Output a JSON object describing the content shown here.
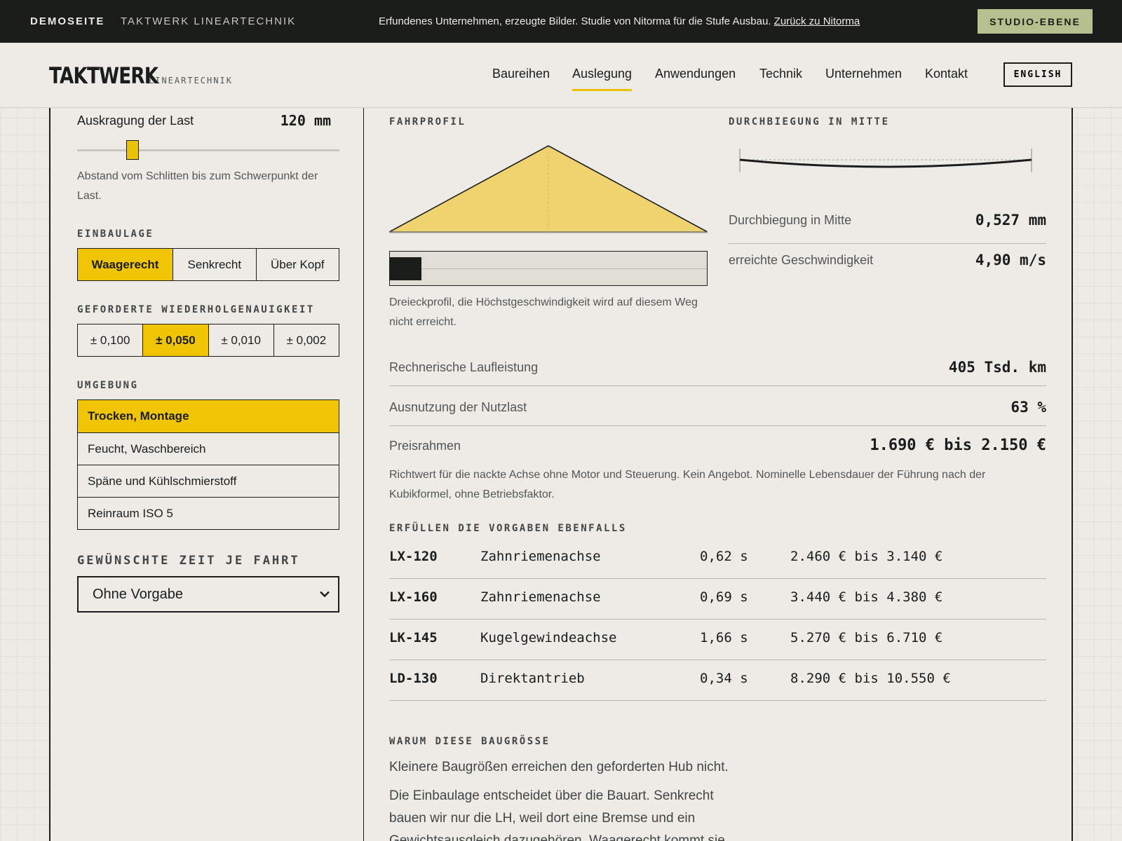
{
  "topbar": {
    "demo_label": "DEMOSEITE",
    "company_label": "TAKTWERK LINEARTECHNIK",
    "notice": "Erfundenes Unternehmen, erzeugte Bilder. Studie von Nitorma für die Stufe Ausbau.",
    "back_link": "Zurück zu Nitorma",
    "studio_button": "STUDIO-EBENE"
  },
  "header": {
    "logo_word": "TAKTWERK",
    "logo_sub": "LINEARTECHNIK",
    "nav": [
      "Baureihen",
      "Auslegung",
      "Anwendungen",
      "Technik",
      "Unternehmen",
      "Kontakt"
    ],
    "active_nav": "Auslegung",
    "lang_button": "ENGLISH"
  },
  "config": {
    "overhang_label": "Auskragung der Last",
    "overhang_value": "120 mm",
    "overhang_fraction": 0.21,
    "overhang_help": "Abstand vom Schlitten bis zum Schwerpunkt der Last.",
    "mounting_label": "EINBAULAGE",
    "mounting_options": [
      "Waagerecht",
      "Senkrecht",
      "Über Kopf"
    ],
    "mounting_selected": "Waagerecht",
    "accuracy_label": "GEFORDERTE WIEDERHOLGENAUIGKEIT",
    "accuracy_options": [
      "± 0,100",
      "± 0,050",
      "± 0,010",
      "± 0,002"
    ],
    "accuracy_selected": "± 0,050",
    "environment_label": "UMGEBUNG",
    "environment_options": [
      "Trocken, Montage",
      "Feucht, Waschbereich",
      "Späne und Kühlschmierstoff",
      "Reinraum ISO 5"
    ],
    "environment_selected": "Trocken, Montage",
    "time_label": "GEWÜNSCHTE ZEIT JE FAHRT",
    "time_select_value": "Ohne Vorgabe"
  },
  "results": {
    "profile_label": "FAHRPROFIL",
    "profile_progress": 0.1,
    "profile_caption": "Dreieckprofil, die Höchstgeschwindigkeit wird auf diesem Weg nicht erreicht.",
    "deflection_label": "DURCHBIEGUNG IN MITTE",
    "deflection_row_label": "Durchbiegung in Mitte",
    "deflection_row_value": "0,527 mm",
    "speed_row_label": "erreichte Geschwindigkeit",
    "speed_row_value": "4,90 m/s",
    "life_label": "Rechnerische Laufleistung",
    "life_value": "405 Tsd. km",
    "payload_label": "Ausnutzung der Nutzlast",
    "payload_value": "63 %",
    "price_label": "Preisrahmen",
    "price_value": "1.690 € bis 2.150 €",
    "note": "Richtwert für die nackte Achse ohne Motor und Steuerung. Kein Angebot. Nominelle Lebensdauer der Führung nach der Kubikformel, ohne Betriebsfaktor.",
    "alternatives_label": "ERFÜLLEN DIE VORGABEN EBENFALLS",
    "alternatives": [
      {
        "code": "LX-120",
        "type": "Zahnriemenachse",
        "time": "0,62 s",
        "price": "2.460 € bis 3.140 €"
      },
      {
        "code": "LX-160",
        "type": "Zahnriemenachse",
        "time": "0,69 s",
        "price": "3.440 € bis 4.380 €"
      },
      {
        "code": "LK-145",
        "type": "Kugelgewindeachse",
        "time": "1,66 s",
        "price": "5.270 € bis 6.710 €"
      },
      {
        "code": "LD-130",
        "type": "Direktantrieb",
        "time": "0,34 s",
        "price": "8.290 € bis 10.550 €"
      }
    ],
    "why_label": "WARUM DIESE BAUGRÖSSE",
    "why_p1": "Kleinere Baugrößen erreichen den geforderten Hub nicht.",
    "why_p2": "Die Einbaulage entscheidet über die Bauart. Senkrecht bauen wir nur die LH, weil dort eine Bremse und ein Gewichtsausgleich dazugehören. Waagerecht kommt sie"
  },
  "colors": {
    "accent": "#f0c505",
    "dark": "#1b1d1a",
    "studio": "#b4c08d",
    "background": "#ecebe6"
  }
}
